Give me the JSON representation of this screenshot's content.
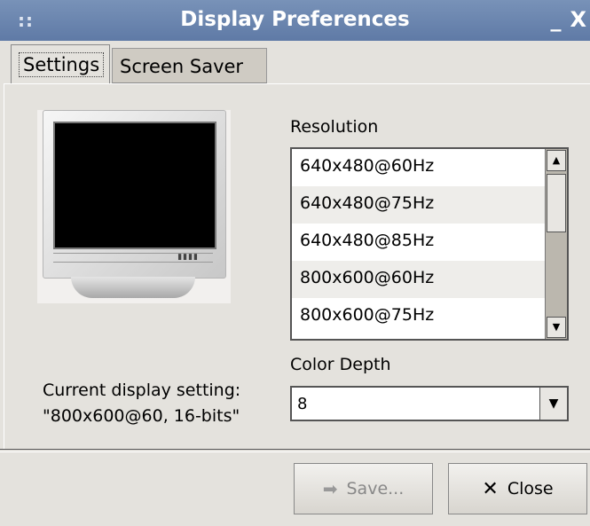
{
  "window": {
    "title": "Display Preferences",
    "grip": "::",
    "minimize": "_",
    "close": "X"
  },
  "tabs": [
    {
      "label": "Settings",
      "mnemonic_index": 1
    },
    {
      "label": "Screen Saver",
      "mnemonic_index": 2
    }
  ],
  "resolution": {
    "label": "Resolution",
    "items": [
      "640x480@60Hz",
      "640x480@75Hz",
      "640x480@85Hz",
      "800x600@60Hz",
      "800x600@75Hz"
    ]
  },
  "color_depth": {
    "label": "Color Depth",
    "value": "8"
  },
  "current_setting": {
    "line1": "Current display setting:",
    "line2": "\"800x600@60, 16-bits\""
  },
  "buttons": {
    "save": {
      "label": "Save...",
      "icon": "arrow-right-icon"
    },
    "close": {
      "label": "Close",
      "icon": "x-icon"
    }
  },
  "colors": {
    "titlebar": "#6b86b0",
    "background": "#e4e2dd"
  }
}
